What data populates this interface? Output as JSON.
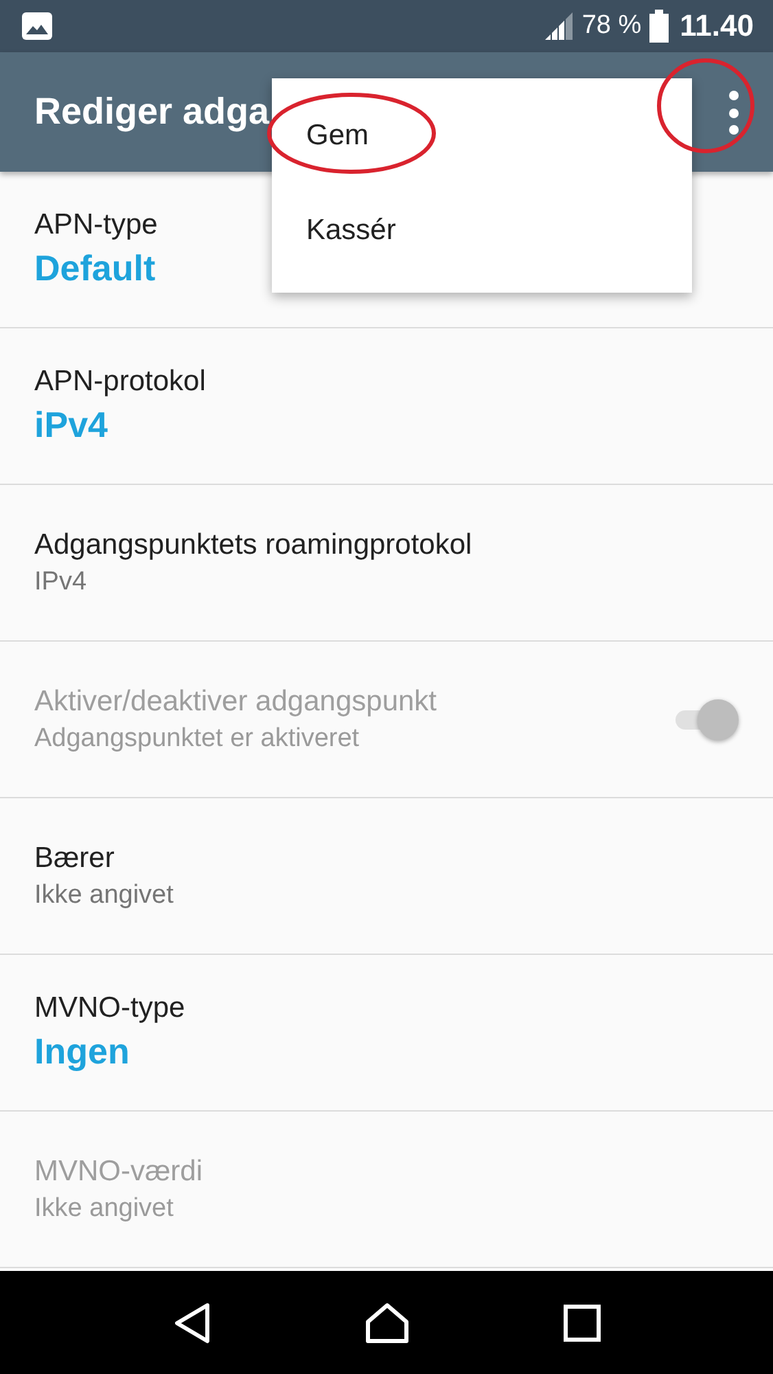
{
  "status_bar": {
    "battery_text": "78 %",
    "time": "11.40"
  },
  "app_bar": {
    "title": "Rediger adga",
    "overflow_circled": true
  },
  "menu": [
    {
      "label": "Gem",
      "circled": true
    },
    {
      "label": "Kassér",
      "circled": false
    }
  ],
  "settings": [
    {
      "kind": "list",
      "title": "APN-type",
      "value": "Default",
      "disabled": false
    },
    {
      "kind": "list",
      "title": "APN-protokol",
      "value": "iPv4",
      "disabled": false
    },
    {
      "kind": "text",
      "title": "Adgangspunktets roamingprotokol",
      "value": "IPv4",
      "disabled": false
    },
    {
      "kind": "switch",
      "title": "Aktiver/deaktiver adgangspunkt",
      "value": "Adgangspunktet er aktiveret",
      "disabled": true,
      "on": true
    },
    {
      "kind": "text",
      "title": "Bærer",
      "value": "Ikke angivet",
      "disabled": false
    },
    {
      "kind": "list",
      "title": "MVNO-type",
      "value": "Ingen",
      "disabled": false
    },
    {
      "kind": "text",
      "title": "MVNO-værdi",
      "value": "Ikke angivet",
      "disabled": true
    }
  ]
}
